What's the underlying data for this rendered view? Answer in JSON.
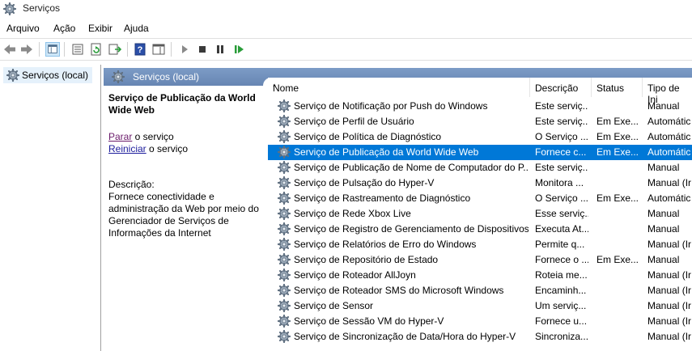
{
  "window": {
    "title": "Serviços"
  },
  "menu": [
    "Arquivo",
    "Ação",
    "Exibir",
    "Ajuda"
  ],
  "toolbar": {
    "icons": [
      "back-arrow-icon",
      "forward-arrow-icon",
      "console-tree-icon",
      "properties-icon",
      "refresh-icon",
      "export-list-icon",
      "help-icon",
      "show-hide-action-pane-icon",
      "start-service-icon",
      "stop-service-icon",
      "pause-service-icon",
      "resume-service-icon"
    ]
  },
  "tree": {
    "node_label": "Serviços (local)"
  },
  "main": {
    "header": "Serviços (local)",
    "details": {
      "title": "Serviço de Publicação da World Wide Web",
      "stop_link": "Parar",
      "stop_suffix": " o serviço",
      "restart_link": "Reiniciar",
      "restart_suffix": " o serviço",
      "desc_label": "Descrição:",
      "desc_text": "Fornece conectividade e administração da Web por meio do Gerenciador de Serviços de Informações da Internet"
    },
    "columns": {
      "name": "Nome",
      "description": "Descrição",
      "status": "Status",
      "startup": "Tipo de Ini"
    },
    "rows": [
      {
        "name": "Serviço de Notificação por Push do Windows",
        "desc": "Este serviç...",
        "status": "",
        "startup": "Manual"
      },
      {
        "name": "Serviço de Perfil de Usuário",
        "desc": "Este serviç...",
        "status": "Em Exe...",
        "startup": "Automátic"
      },
      {
        "name": "Serviço de Política de Diagnóstico",
        "desc": "O Serviço ...",
        "status": "Em Exe...",
        "startup": "Automátic"
      },
      {
        "name": "Serviço de Publicação da World Wide Web",
        "desc": "Fornece c...",
        "status": "Em Exe...",
        "startup": "Automátic"
      },
      {
        "name": "Serviço de Publicação de Nome de Computador do P...",
        "desc": "Este serviç...",
        "status": "",
        "startup": "Manual"
      },
      {
        "name": "Serviço de Pulsação do Hyper-V",
        "desc": "Monitora ...",
        "status": "",
        "startup": "Manual (Ir"
      },
      {
        "name": "Serviço de Rastreamento de Diagnóstico",
        "desc": "O Serviço ...",
        "status": "Em Exe...",
        "startup": "Automátic"
      },
      {
        "name": "Serviço de Rede Xbox Live",
        "desc": "Esse serviç...",
        "status": "",
        "startup": "Manual"
      },
      {
        "name": "Serviço de Registro de Gerenciamento de Dispositivos",
        "desc": "Executa At...",
        "status": "",
        "startup": "Manual"
      },
      {
        "name": "Serviço de Relatórios de Erro do Windows",
        "desc": "Permite q...",
        "status": "",
        "startup": "Manual (Ir"
      },
      {
        "name": "Serviço de Repositório de Estado",
        "desc": "Fornece o ...",
        "status": "Em Exe...",
        "startup": "Manual"
      },
      {
        "name": "Serviço de Roteador AllJoyn",
        "desc": "Roteia me...",
        "status": "",
        "startup": "Manual (Ir"
      },
      {
        "name": "Serviço de Roteador SMS do Microsoft Windows",
        "desc": "Encaminh...",
        "status": "",
        "startup": "Manual (Ir"
      },
      {
        "name": "Serviço de Sensor",
        "desc": "Um serviç...",
        "status": "",
        "startup": "Manual (Ir"
      },
      {
        "name": "Serviço de Sessão VM do Hyper-V",
        "desc": "Fornece u...",
        "status": "",
        "startup": "Manual (Ir"
      },
      {
        "name": "Serviço de Sincronização de Data/Hora do Hyper-V",
        "desc": "Sincroniza...",
        "status": "",
        "startup": "Manual (Ir"
      }
    ],
    "selected_index": 3
  },
  "colors": {
    "selection": "#0078d7",
    "header_band": "#6c8fbd",
    "play_green": "#2a9d3a"
  }
}
